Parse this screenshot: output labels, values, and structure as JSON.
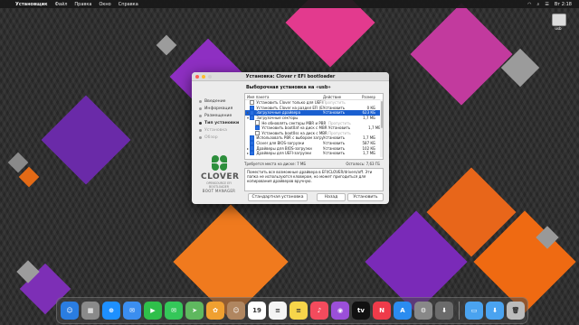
{
  "menubar": {
    "app_name": "Установщик",
    "items": [
      "Файл",
      "Правка",
      "Окно",
      "Справка"
    ],
    "time": "Вт 2:18"
  },
  "desktop": {
    "disk_label": "usb"
  },
  "window": {
    "title": "Установка: Clover r EFI bootloader",
    "steps": [
      {
        "label": "Введение",
        "state": "done"
      },
      {
        "label": "Информация",
        "state": "done"
      },
      {
        "label": "Размещение",
        "state": "done"
      },
      {
        "label": "Тип установки",
        "state": "active"
      },
      {
        "label": "Установка",
        "state": "pending"
      },
      {
        "label": "Обзор",
        "state": "pending"
      }
    ],
    "logo": {
      "name": "CLOVER",
      "subtitle": "OPENSOURCE EFI BOOTLOADER",
      "tagline": "BOOT MANAGER"
    },
    "heading": "Выборочная установка на «usb»",
    "columns": {
      "name": "Имя пакета",
      "action": "Действие",
      "size": "Размер"
    },
    "packages": [
      {
        "name": "Установить Clover только для UEFI-з...",
        "action": "Пропустить",
        "size": "",
        "checked": false,
        "indent": 0,
        "tri": "",
        "selected": false
      },
      {
        "name": "Установить Clover на раздел EFI (ESP)",
        "action": "Установить",
        "size": "0 КБ",
        "checked": true,
        "indent": 0,
        "tri": "",
        "selected": false
      },
      {
        "name": "Загрузочные драйвера",
        "action": "Установить",
        "size": "623 КБ",
        "checked": true,
        "indent": 0,
        "tri": "▸",
        "selected": true
      },
      {
        "name": "Загрузочные секторы",
        "action": "",
        "size": "1,7 МБ",
        "checked": true,
        "indent": 0,
        "tri": "▾",
        "selected": false
      },
      {
        "name": "Не обновлять секторы MBR и PBR",
        "action": "Пропустить",
        "size": "",
        "checked": false,
        "indent": 2,
        "tri": "",
        "selected": false
      },
      {
        "name": "Установить boot0af на диск с MBR",
        "action": "Установить",
        "size": "1,7 МБ",
        "checked": true,
        "indent": 2,
        "tri": "",
        "selected": false
      },
      {
        "name": "Установить boot0ss на диск с MBR",
        "action": "Пропустить",
        "size": "",
        "checked": false,
        "indent": 2,
        "tri": "",
        "selected": false
      },
      {
        "name": "Использовать PBR с выбором загруз...",
        "action": "Установить",
        "size": "1,7 МБ",
        "checked": true,
        "indent": 0,
        "tri": "",
        "selected": false
      },
      {
        "name": "Clover для BIOS-загрузки",
        "action": "Установить",
        "size": "587 КБ",
        "checked": true,
        "indent": 0,
        "tri": "",
        "selected": false
      },
      {
        "name": "Драйверы для BIOS-загрузки",
        "action": "Установить",
        "size": "102 КБ",
        "checked": true,
        "indent": 0,
        "tri": "▸",
        "selected": false
      },
      {
        "name": "Драйверы для UEFI-загрузки",
        "action": "Установить",
        "size": "1,7 МБ",
        "checked": true,
        "indent": 0,
        "tri": "▸",
        "selected": false
      }
    ],
    "required_label": "Требуется места на диске:  7 МБ",
    "remaining_label": "Осталось:  7,63 ГБ",
    "description": "Поместить все возможные драйвера в EFI/CLOVER/drivers/off. Эти папка не используются кловером, но может пригодиться для копирования драйверов вручную.",
    "buttons": {
      "standard": "Стандартная установка",
      "back": "Назад",
      "install": "Установить"
    }
  },
  "dock": {
    "apps": [
      {
        "name": "finder",
        "color": "#2a7de1",
        "glyph": "☺"
      },
      {
        "name": "launchpad",
        "color": "#8a8a8a",
        "glyph": "▦"
      },
      {
        "name": "safari",
        "color": "#1e90ff",
        "glyph": "⊕"
      },
      {
        "name": "mail",
        "color": "#3b8ef0",
        "glyph": "✉"
      },
      {
        "name": "facetime",
        "color": "#2fbf4a",
        "glyph": "▶"
      },
      {
        "name": "messages",
        "color": "#34c759",
        "glyph": "✉"
      },
      {
        "name": "maps",
        "color": "#5fb85f",
        "glyph": "➤"
      },
      {
        "name": "photos",
        "color": "#f0a030",
        "glyph": "✿"
      },
      {
        "name": "contacts",
        "color": "#b08660",
        "glyph": "☺"
      },
      {
        "name": "calendar",
        "color": "#ffffff",
        "glyph": "19"
      },
      {
        "name": "reminders",
        "color": "#f4f4f4",
        "glyph": "≡"
      },
      {
        "name": "notes",
        "color": "#f7d54a",
        "glyph": "≡"
      },
      {
        "name": "music",
        "color": "#f34b5d",
        "glyph": "♪"
      },
      {
        "name": "podcasts",
        "color": "#9b4fd9",
        "glyph": "◉"
      },
      {
        "name": "tv",
        "color": "#111111",
        "glyph": "tv"
      },
      {
        "name": "news",
        "color": "#ef3b4a",
        "glyph": "N"
      },
      {
        "name": "app-store",
        "color": "#2b8cf0",
        "glyph": "A"
      },
      {
        "name": "system-preferences",
        "color": "#888888",
        "glyph": "⚙"
      },
      {
        "name": "installer",
        "color": "#6b6b6b",
        "glyph": "⬇"
      },
      {
        "name": "folder-1",
        "color": "#4aa3f0",
        "glyph": "▭"
      },
      {
        "name": "folder-2",
        "color": "#4aa3f0",
        "glyph": "⬇"
      },
      {
        "name": "trash",
        "color": "#bbbbbb",
        "glyph": "🗑"
      }
    ]
  },
  "colors": {
    "accent": "#1a5fd0",
    "window_bg": "#ececec"
  }
}
